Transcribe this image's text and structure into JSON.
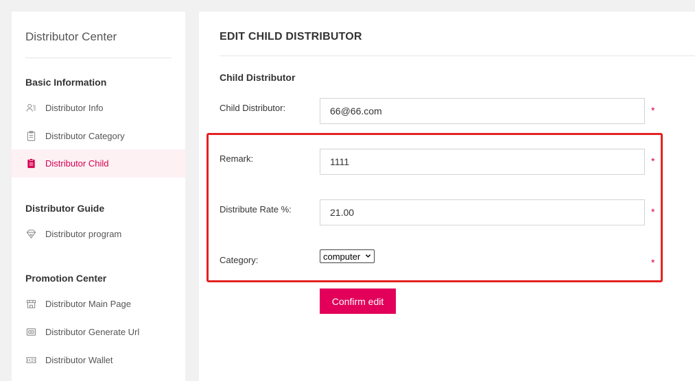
{
  "sidebar": {
    "title": "Distributor Center",
    "sections": [
      {
        "title": "Basic Information",
        "items": [
          {
            "label": "Distributor Info",
            "icon": "user-card-icon",
            "active": false
          },
          {
            "label": "Distributor Category",
            "icon": "clipboard-icon",
            "active": false
          },
          {
            "label": "Distributor Child",
            "icon": "clipboard-filled-icon",
            "active": true
          }
        ]
      },
      {
        "title": "Distributor Guide",
        "items": [
          {
            "label": "Distributor program",
            "icon": "diamond-icon",
            "active": false
          }
        ]
      },
      {
        "title": "Promotion Center",
        "items": [
          {
            "label": "Distributor Main Page",
            "icon": "store-icon",
            "active": false
          },
          {
            "label": "Distributor Generate Url",
            "icon": "link-card-icon",
            "active": false
          },
          {
            "label": "Distributor Wallet",
            "icon": "wallet-ticket-icon",
            "active": false
          }
        ]
      }
    ]
  },
  "main": {
    "title": "EDIT CHILD DISTRIBUTOR",
    "section_title": "Child Distributor",
    "fields": {
      "child_distributor": {
        "label": "Child Distributor:",
        "value": "66@66.com"
      },
      "remark": {
        "label": "Remark:",
        "value": "1111"
      },
      "rate": {
        "label": "Distribute Rate %:",
        "value": "21.00"
      },
      "category": {
        "label": "Category:",
        "value": "computer"
      }
    },
    "required_mark": "*",
    "confirm_label": "Confirm edit"
  },
  "colors": {
    "accent": "#e2005a",
    "active_bg": "#fdf1f4",
    "highlight": "#e32222"
  }
}
